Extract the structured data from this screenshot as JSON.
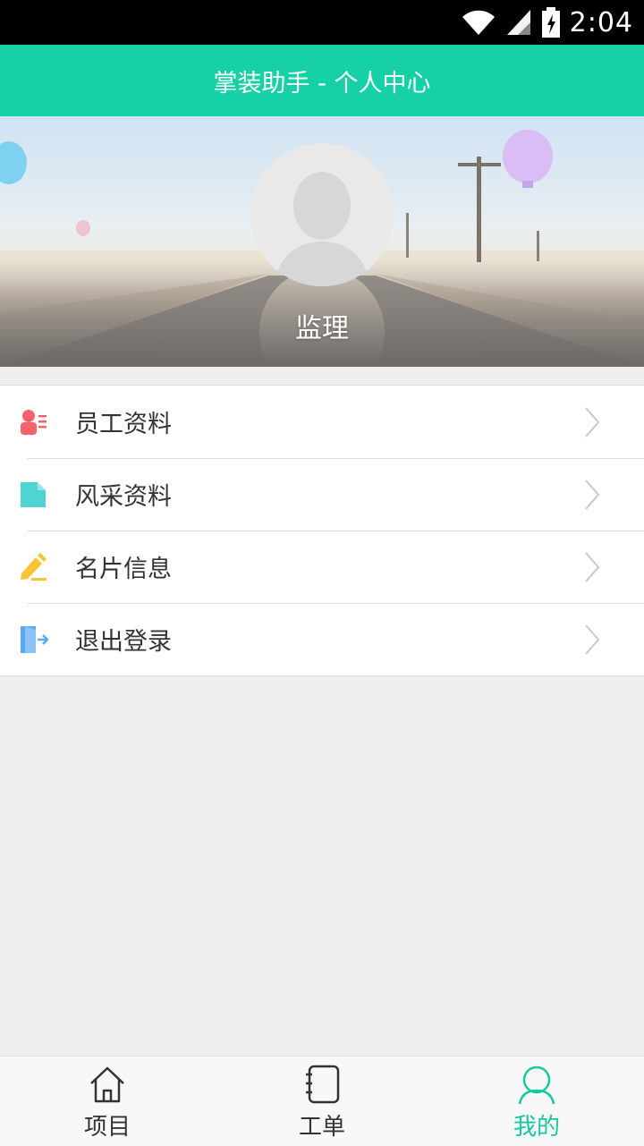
{
  "status_bar": {
    "time": "2:04"
  },
  "header": {
    "title": "掌装助手 - 个人中心"
  },
  "profile": {
    "name": "监理"
  },
  "menu": [
    {
      "label": "员工资料",
      "icon": "employee-card-icon",
      "color": "#f4636b"
    },
    {
      "label": "风采资料",
      "icon": "document-icon",
      "color": "#4fd3d3"
    },
    {
      "label": "名片信息",
      "icon": "pencil-icon",
      "color": "#f7c531"
    },
    {
      "label": "退出登录",
      "icon": "logout-icon",
      "color": "#5ba8f5"
    }
  ],
  "bottom_nav": {
    "items": [
      {
        "label": "项目",
        "icon": "home-icon",
        "active": false
      },
      {
        "label": "工单",
        "icon": "notebook-icon",
        "active": false
      },
      {
        "label": "我的",
        "icon": "user-icon",
        "active": true
      }
    ]
  },
  "colors": {
    "accent": "#17d1a6",
    "active_tab": "#17c99f",
    "background": "#efefef"
  }
}
